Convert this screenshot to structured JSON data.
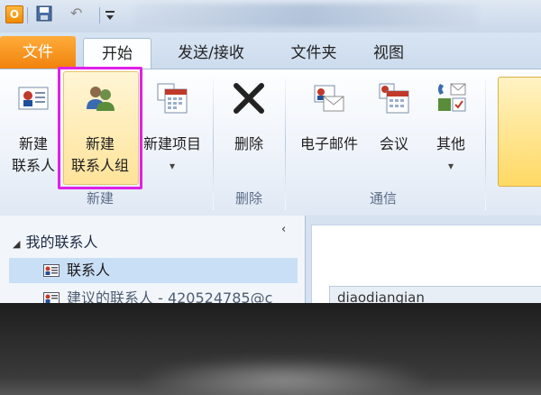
{
  "quick_access": {
    "app_icon": "outlook-logo",
    "app_letter": "O",
    "icons": [
      "outlook-icon",
      "save-icon",
      "undo-icon",
      "customize-icon"
    ]
  },
  "tabs": [
    {
      "label": "文件",
      "state": "file"
    },
    {
      "label": "开始",
      "state": "active"
    },
    {
      "label": "发送/接收",
      "state": "normal"
    },
    {
      "label": "文件夹",
      "state": "normal"
    },
    {
      "label": "视图",
      "state": "normal"
    }
  ],
  "ribbon": {
    "groups": [
      {
        "label": "新建",
        "buttons": [
          {
            "line1": "新建",
            "line2": "联系人",
            "icon": "new-contact-icon"
          },
          {
            "line1": "新建",
            "line2": "联系人组",
            "icon": "new-contact-group-icon",
            "highlighted": true
          },
          {
            "line1": "新建项目",
            "line2": "▾",
            "icon": "new-items-icon"
          }
        ]
      },
      {
        "label": "删除",
        "buttons": [
          {
            "line1": "删除",
            "icon": "delete-icon"
          }
        ]
      },
      {
        "label": "通信",
        "buttons": [
          {
            "line1": "电子邮件",
            "icon": "email-icon"
          },
          {
            "line1": "会议",
            "icon": "meeting-icon"
          },
          {
            "line1": "其他",
            "line2": "▾",
            "icon": "more-icon"
          }
        ]
      }
    ]
  },
  "nav_pane": {
    "collapse_glyph": "‹",
    "header_glyph": "◢",
    "header": "我的联系人",
    "items": [
      {
        "label": "联系人",
        "selected": true
      },
      {
        "label": "建议的联系人 - 420524785@c",
        "selected": false
      }
    ]
  },
  "content": {
    "search_text": "diaodiangian"
  },
  "colors": {
    "file_tab": "#f1820d",
    "highlight_box": "#e020e6",
    "ribbon_bg": "#eef3fa",
    "selected_item": "#c9dff6"
  }
}
